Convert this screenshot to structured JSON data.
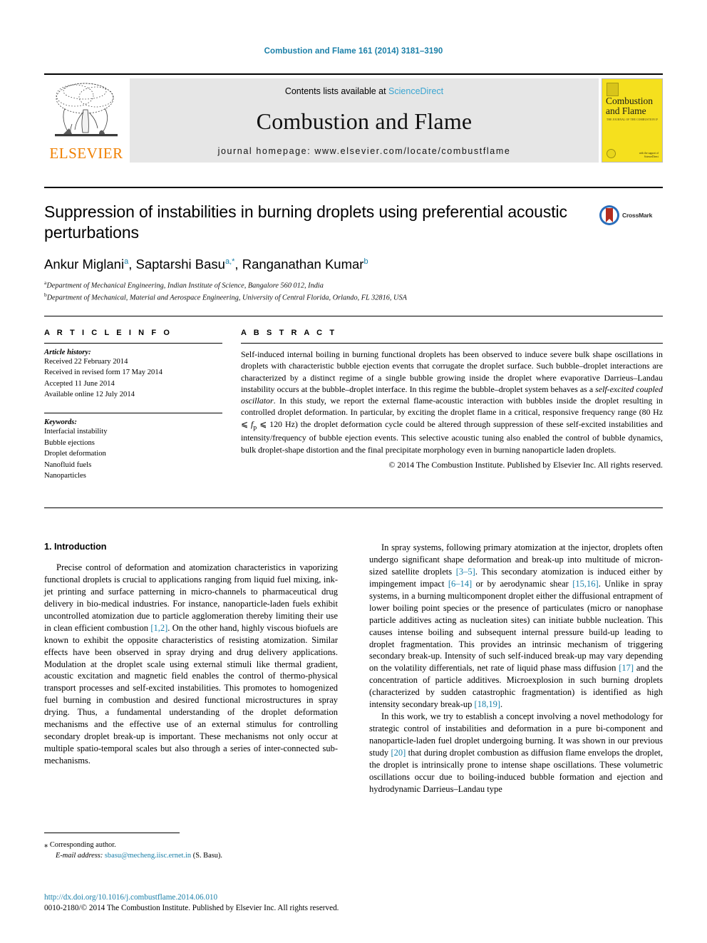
{
  "running_head": "Combustion and Flame 161 (2014) 3181–3190",
  "masthead": {
    "publisher_logo_text": "ELSEVIER",
    "publisher_logo_icon": "elsevier-tree-icon",
    "contents_prefix": "Contents lists available at ",
    "contents_link": "ScienceDirect",
    "journal_title": "Combustion and Flame",
    "homepage": "journal homepage: www.elsevier.com/locate/combustflame",
    "cover": {
      "title_line1": "Combustion",
      "title_line2": "and Flame",
      "subtitle": "THE JOURNAL OF THE COMBUSTION INSTITUTE",
      "badge_line1": "with the support of",
      "badge_line2": "ScienceDirect",
      "background_color": "#f5e01e"
    }
  },
  "article": {
    "title": "Suppression of instabilities in burning droplets using preferential acoustic perturbations",
    "authors": [
      {
        "name": "Ankur Miglani",
        "sup": "a"
      },
      {
        "name": "Saptarshi Basu",
        "sup": "a,*"
      },
      {
        "name": "Ranganathan Kumar",
        "sup": "b"
      }
    ],
    "authors_line": "Ankur Miglani a, Saptarshi Basu a,*, Ranganathan Kumar b",
    "affiliations": [
      {
        "sup": "a",
        "text": "Department of Mechanical Engineering, Indian Institute of Science, Bangalore 560 012, India"
      },
      {
        "sup": "b",
        "text": "Department of Mechanical, Material and Aerospace Engineering, University of Central Florida, Orlando, FL 32816, USA"
      }
    ],
    "crossmark": {
      "label": "CrossMark",
      "icon": "crossmark-icon",
      "circle_color": "#2a6ebb",
      "ribbon_color": "#b32d20"
    }
  },
  "info": {
    "heading": "A R T I C L E  I N F O",
    "history_label": "Article history:",
    "history": [
      "Received 22 February 2014",
      "Received in revised form 17 May 2014",
      "Accepted 11 June 2014",
      "Available online 12 July 2014"
    ],
    "keywords_label": "Keywords:",
    "keywords": [
      "Interfacial instability",
      "Bubble ejections",
      "Droplet deformation",
      "Nanofluid fuels",
      "Nanoparticles"
    ]
  },
  "abstract": {
    "heading": "A B S T R A C T",
    "part1": "Self-induced internal boiling in burning functional droplets has been observed to induce severe bulk shape oscillations in droplets with characteristic bubble ejection events that corrugate the droplet surface. Such bubble–droplet interactions are characterized by a distinct regime of a single bubble growing inside the droplet where evaporative Darrieus–Landau instability occurs at the bubble–droplet interface. In this regime the bubble–droplet system behaves as a ",
    "italic1": "self-excited coupled oscillator",
    "part2": ". In this study, we report the external flame-acoustic interaction with bubbles inside the droplet resulting in controlled droplet deformation. In particular, by exciting the droplet flame in a critical, responsive frequency range (80 Hz ⩽ ",
    "italic2": "f",
    "sub2": "p",
    "part3": " ⩽ 120 Hz) the droplet deformation cycle could be altered through suppression of these self-excited instabilities and intensity/frequency of bubble ejection events. This selective acoustic tuning also enabled the control of bubble dynamics, bulk droplet-shape distortion and the final precipitate morphology even in burning nanoparticle laden droplets.",
    "copyright": "© 2014 The Combustion Institute. Published by Elsevier Inc. All rights reserved."
  },
  "body": {
    "section1_heading": "1. Introduction",
    "left_paragraph_1": "Precise control of deformation and atomization characteristics in vaporizing functional droplets is crucial to applications ranging from liquid fuel mixing, ink-jet printing and surface patterning in micro-channels to pharmaceutical drug delivery in bio-medical industries. For instance, nanoparticle-laden fuels exhibit uncontrolled atomization due to particle agglomeration thereby limiting their use in clean efficient combustion ",
    "left_ref_1": "[1,2]",
    "left_paragraph_1b": ". On the other hand, highly viscous biofuels are known to exhibit the opposite characteristics of resisting atomization. Similar effects have been observed in spray drying and drug delivery applications. Modulation at the droplet scale using external stimuli like thermal gradient, acoustic excitation and magnetic field enables the control of thermo-physical transport processes and self-excited instabilities. This promotes to homogenized fuel burning in combustion and desired functional microstructures in spray drying. Thus, a fundamental understanding of the droplet deformation mechanisms and the effective use of an external stimulus for controlling secondary droplet break-up is important. These mechanisms not only occur at multiple spatio-temporal scales but also through a series of inter-connected sub-mechanisms.",
    "right_paragraph_1a": "In spray systems, following primary atomization at the injector, droplets often undergo significant shape deformation and break-up into multitude of micron-sized satellite droplets ",
    "right_ref_1": "[3–5]",
    "right_paragraph_1b": ". This secondary atomization is induced either by impingement impact ",
    "right_ref_2": "[6–14]",
    "right_paragraph_1c": " or by aerodynamic shear ",
    "right_ref_3": "[15,16]",
    "right_paragraph_1d": ". Unlike in spray systems, in a burning multicomponent droplet either the diffusional entrapment of lower boiling point species or the presence of particulates (micro or nanophase particle additives acting as nucleation sites) can initiate bubble nucleation. This causes intense boiling and subsequent internal pressure build-up leading to droplet fragmentation. This provides an intrinsic mechanism of triggering secondary break-up. Intensity of such self-induced break-up may vary depending on the volatility differentials, net rate of liquid phase mass diffusion ",
    "right_ref_4": "[17]",
    "right_paragraph_1e": " and the concentration of particle additives. Microexplosion in such burning droplets (characterized by sudden catastrophic fragmentation) is identified as high intensity secondary break-up ",
    "right_ref_5": "[18,19]",
    "right_paragraph_1f": ".",
    "right_paragraph_2a": "In this work, we try to establish a concept involving a novel methodology for strategic control of instabilities and deformation in a pure bi-component and nanoparticle-laden fuel droplet undergoing burning. It was shown in our previous study ",
    "right_ref_6": "[20]",
    "right_paragraph_2b": " that during droplet combustion as diffusion flame envelops the droplet, the droplet is intrinsically prone to intense shape oscillations. These volumetric oscillations occur due to boiling-induced bubble formation and ejection and hydrodynamic Darrieus–Landau type"
  },
  "footer": {
    "corresponding_marker": "⁎",
    "corresponding_text": "Corresponding author.",
    "email_label": "E-mail address:",
    "email": "sbasu@mecheng.iisc.ernet.in",
    "email_attribution": "(S. Basu).",
    "doi": "http://dx.doi.org/10.1016/j.combustflame.2014.06.010",
    "issn_line": "0010-2180/© 2014 The Combustion Institute. Published by Elsevier Inc. All rights reserved."
  }
}
